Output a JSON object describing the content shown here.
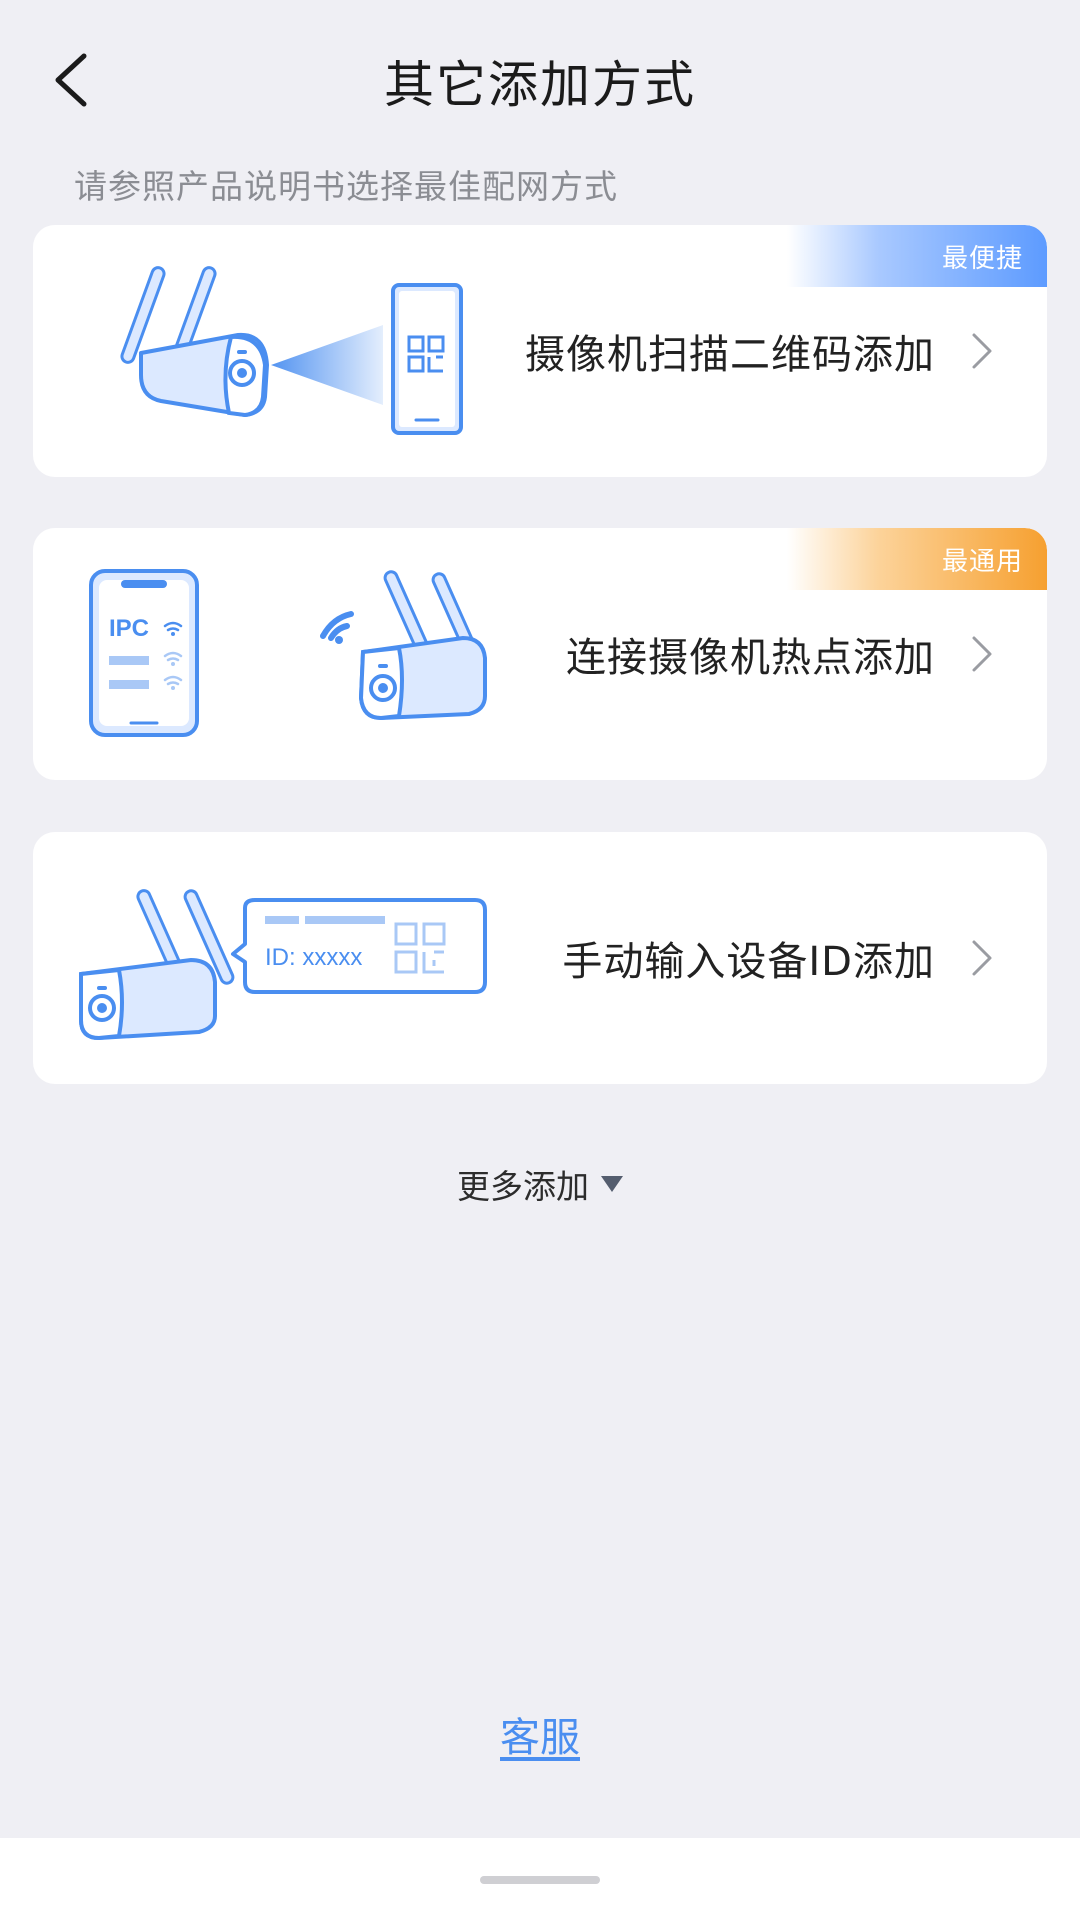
{
  "header": {
    "title": "其它添加方式"
  },
  "subtitle": "请参照产品说明书选择最佳配网方式",
  "options": [
    {
      "label": "摄像机扫描二维码添加",
      "badge": "最便捷",
      "badge_color": "#5d9bff"
    },
    {
      "label": "连接摄像机热点添加",
      "badge": "最通用",
      "badge_color": "#f6a030",
      "illus_text": "IPC"
    },
    {
      "label": "手动输入设备ID添加",
      "illus_text": "ID: xxxxx"
    }
  ],
  "more_add": "更多添加",
  "customer_service": "客服",
  "colors": {
    "background": "#efeff4",
    "accent": "#4a8ef0",
    "illustration_blue": "#4a8ef0",
    "illustration_fill": "#dce9ff"
  }
}
